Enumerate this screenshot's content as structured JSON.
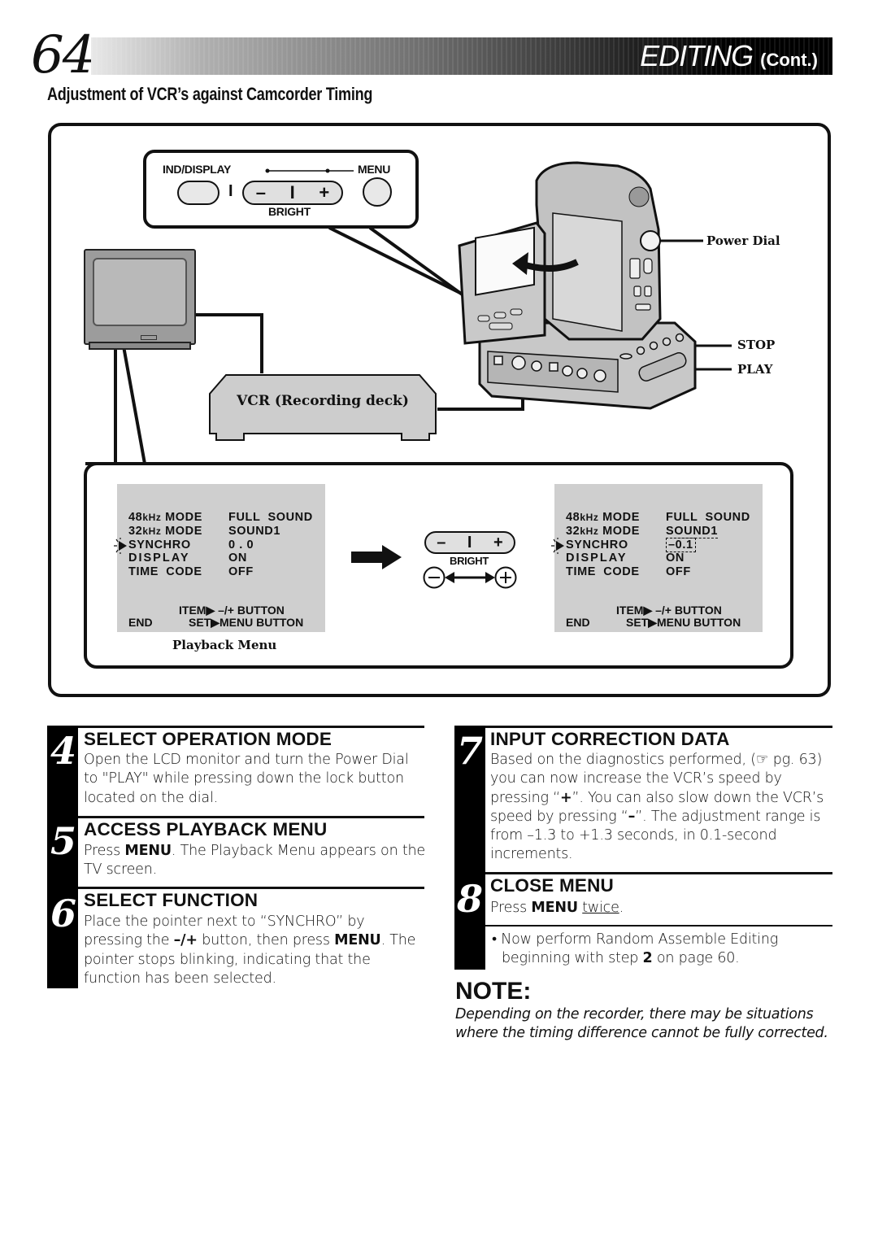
{
  "header": {
    "page_number": "64",
    "chapter_title": "EDITING",
    "chapter_suffix": "(Cont.)"
  },
  "section_title": "Adjustment of VCR’s against Camcorder Timing",
  "diagram": {
    "control_panel": {
      "ind_display_label": "IND/DISPLAY",
      "menu_label": "MENU",
      "bright_label": "BRIGHT",
      "minus_glyph": "–",
      "divider_glyph": "I",
      "plus_glyph": "+"
    },
    "callouts": {
      "power_dial": "Power Dial",
      "stop": "STOP",
      "play": "PLAY"
    },
    "vcr_label": "VCR (Recording deck)",
    "bright_control": {
      "label": "BRIGHT",
      "minus_glyph": "–",
      "divider_glyph": "I",
      "plus_glyph": "+"
    },
    "playback_menu_caption": "Playback Menu",
    "menu_before": {
      "rows": [
        {
          "key_prefix": "48",
          "key_unit": "kHz",
          "key_suffix": " MODE",
          "value": "FULL  SOUND"
        },
        {
          "key_prefix": "32",
          "key_unit": "kHz",
          "key_suffix": " MODE",
          "value": "SOUND1"
        },
        {
          "key_prefix": "SYNCHRO",
          "key_unit": "",
          "key_suffix": "",
          "value": "0 . 0"
        },
        {
          "key_prefix": "DISPLAY",
          "key_unit": "",
          "key_suffix": "",
          "value": "ON"
        },
        {
          "key_prefix": "TIME  CODE",
          "key_unit": "",
          "key_suffix": "",
          "value": "OFF"
        }
      ],
      "footer_item": "ITEM▶ –/+ BUTTON",
      "footer_end": "END",
      "footer_set": "SET▶MENU BUTTON"
    },
    "menu_after": {
      "rows": [
        {
          "key_prefix": "48",
          "key_unit": "kHz",
          "key_suffix": " MODE",
          "value": "FULL  SOUND"
        },
        {
          "key_prefix": "32",
          "key_unit": "kHz",
          "key_suffix": " MODE",
          "value": "SOUND1"
        },
        {
          "key_prefix": "SYNCHRO",
          "key_unit": "",
          "key_suffix": "",
          "value": "–0.1"
        },
        {
          "key_prefix": "DISPLAY",
          "key_unit": "",
          "key_suffix": "",
          "value": "ON"
        },
        {
          "key_prefix": "TIME  CODE",
          "key_unit": "",
          "key_suffix": "",
          "value": "OFF"
        }
      ],
      "footer_item": "ITEM▶ –/+ BUTTON",
      "footer_end": "END",
      "footer_set": "SET▶MENU BUTTON"
    }
  },
  "steps": [
    {
      "number": "4",
      "heading": "SELECT OPERATION MODE",
      "body": "Open the LCD monitor and turn the Power Dial to \"PLAY\" while pressing down the lock button located on the dial."
    },
    {
      "number": "5",
      "heading": "ACCESS PLAYBACK MENU",
      "body_pre": "Press ",
      "body_bold": "MENU",
      "body_post": ". The Playback Menu appears on the TV screen."
    },
    {
      "number": "6",
      "heading": "SELECT FUNCTION",
      "body_pre": "Place the pointer next to “SYNCHRO” by pressing the ",
      "body_bold1": "–/+",
      "body_mid": " button, then press ",
      "body_bold2": "MENU",
      "body_post": ". The pointer stops blinking, indicating that the function has been selected."
    },
    {
      "number": "7",
      "heading": "INPUT CORRECTION DATA",
      "body_pre": "Based on the diagnostics performed, (",
      "ref_icon": "☞",
      "body_ref": " pg. 63) you can now increase the VCR’s speed by pressing “",
      "plus_bold": "+",
      "body_mid": "”. You can also slow down the VCR’s speed by pressing “",
      "minus_bold": "–",
      "body_post": "”. The adjustment range is from –1.3 to +1.3 seconds, in 0.1-second increments."
    },
    {
      "number": "8",
      "heading": "CLOSE MENU",
      "body_pre": "Press ",
      "body_bold": "MENU",
      "body_space": " ",
      "body_underline": "twice",
      "body_post": ".",
      "bullet_pre": "• Now perform Random Assemble Editing beginning with step ",
      "bullet_bold": "2",
      "bullet_post": " on page 60."
    }
  ],
  "note": {
    "heading": "NOTE:",
    "body": "Depending on the recorder, there may be situations where the timing difference cannot be fully corrected."
  }
}
